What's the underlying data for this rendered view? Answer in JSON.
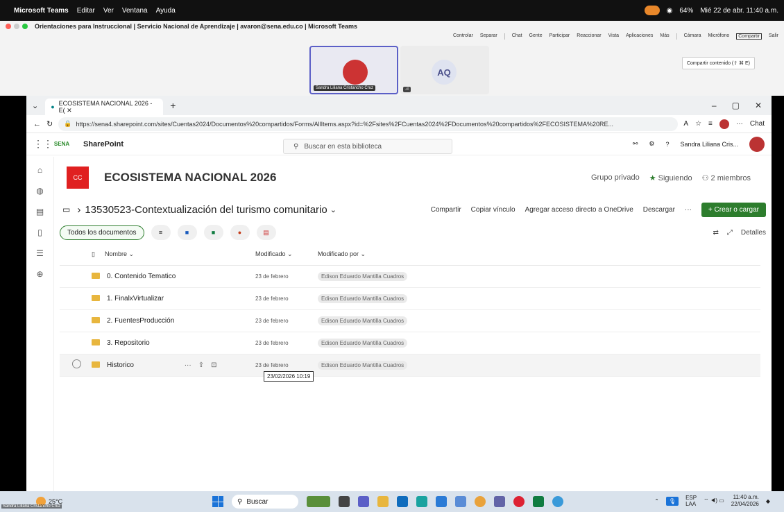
{
  "mac_menu": {
    "app": "Microsoft Teams",
    "items": [
      "Editar",
      "Ver",
      "Ventana",
      "Ayuda"
    ],
    "battery": "64%",
    "datetime": "Mié 22 de abr. 11:40 a.m."
  },
  "teams": {
    "window_title": "Orientaciones para Instruccional | Servicio Nacional de Aprendizaje | avaron@sena.edu.co | Microsoft Teams",
    "toolbar": [
      "Controlar",
      "Separar",
      "Chat",
      "Gente",
      "Participar",
      "Reaccionar",
      "Vista",
      "Aplicaciones",
      "Más",
      "Cámara",
      "Micrófono",
      "Compartir",
      "Salir"
    ],
    "share_tooltip": "Compartir contenido (⇧ ⌘ E)",
    "participant1": "Sandra Liliana Cristancho Cruz",
    "participant2_initials": "AQ"
  },
  "browser": {
    "tab_title": "ECOSISTEMA NACIONAL 2026 - E( ✕",
    "url": "https://sena4.sharepoint.com/sites/Cuentas2024/Documentos%20compartidos/Forms/AllItems.aspx?id=%2Fsites%2FCuentas2024%2FDocumentos%20compartidos%2FECOSISTEMA%20RE...",
    "chat_label": "Chat"
  },
  "sharepoint": {
    "brand": "SharePoint",
    "search_placeholder": "Buscar en esta biblioteca",
    "user_name": "Sandra Liliana Cris...",
    "site_logo": "CC",
    "site_title": "ECOSISTEMA NACIONAL 2026",
    "group": "Grupo privado",
    "following": "Siguiendo",
    "members": "2 miembros",
    "folder_path": "13530523-Contextualización del turismo comunitario",
    "actions": {
      "share": "Compartir",
      "copy_link": "Copiar vínculo",
      "shortcut": "Agregar acceso directo a OneDrive",
      "download": "Descargar",
      "more": "···",
      "new": "+ Crear o cargar"
    },
    "view": "Todos los documentos",
    "details": "Detalles",
    "columns": {
      "name": "Nombre",
      "modified": "Modificado",
      "modified_by": "Modificado por"
    },
    "rows": [
      {
        "name": "0. Contenido Tematico",
        "modified": "23 de febrero",
        "by": "Edison Eduardo Mantilla Cuadros"
      },
      {
        "name": "1. FinalxVirtualizar",
        "modified": "23 de febrero",
        "by": "Edison Eduardo Mantilla Cuadros"
      },
      {
        "name": "2. FuentesProducción",
        "modified": "23 de febrero",
        "by": "Edison Eduardo Mantilla Cuadros"
      },
      {
        "name": "3. Repositorio",
        "modified": "23 de febrero",
        "by": "Edison Eduardo Mantilla Cuadros"
      },
      {
        "name": "Historico",
        "modified": "23 de febrero",
        "by": "Edison Eduardo Mantilla Cuadros"
      }
    ],
    "hover_tooltip": "23/02/2026 10:19"
  },
  "taskbar": {
    "temp": "25°C",
    "search": "Buscar",
    "lang": "ESP",
    "lang2": "LAA",
    "time": "11:40 a.m.",
    "date": "22/04/2026"
  },
  "overlay_name": "Sandra Liliana Cristancho Cruz"
}
